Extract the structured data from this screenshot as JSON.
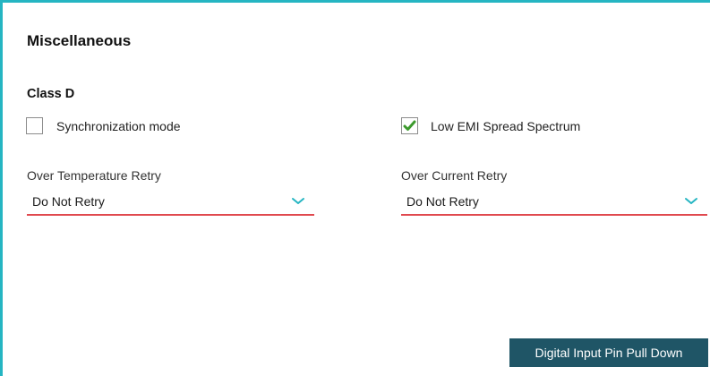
{
  "section": {
    "title": "Miscellaneous"
  },
  "class_d": {
    "title": "Class D",
    "sync_mode": {
      "label": "Synchronization mode",
      "checked": false
    },
    "low_emi": {
      "label": "Low EMI Spread Spectrum",
      "checked": true
    },
    "over_temp_retry": {
      "label": "Over Temperature Retry",
      "value": "Do Not Retry"
    },
    "over_current_retry": {
      "label": "Over Current Retry",
      "value": "Do Not Retry"
    }
  },
  "actions": {
    "pull_down_label": "Digital Input Pin Pull Down"
  },
  "colors": {
    "panel_border": "#25b5c2",
    "select_underline": "#e0494f",
    "chevron": "#25b5c2",
    "check_green": "#3c9a2d",
    "button_bg": "#1f5566",
    "button_text": "#ffffff"
  },
  "icons": {
    "checkmark": "checkmark-icon",
    "dropdown": "chevron-down-icon"
  }
}
